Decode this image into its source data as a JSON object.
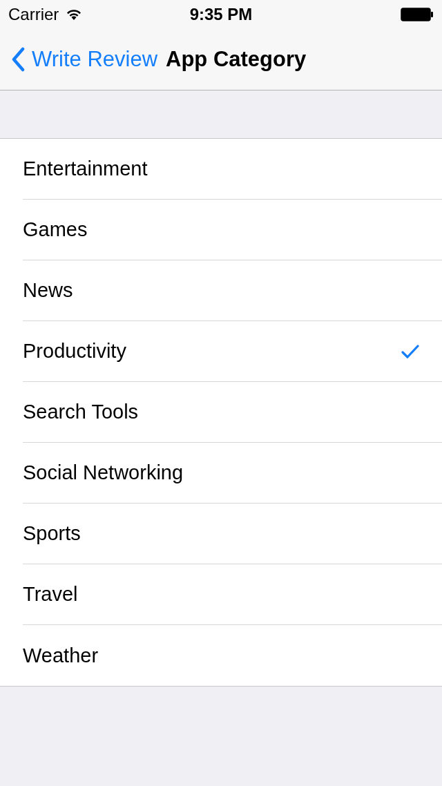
{
  "status_bar": {
    "carrier": "Carrier",
    "time": "9:35 PM"
  },
  "nav_bar": {
    "back": "Write Review",
    "title": "App Category"
  },
  "categories": [
    {
      "label": "Entertainment",
      "selected": false
    },
    {
      "label": "Games",
      "selected": false
    },
    {
      "label": "News",
      "selected": false
    },
    {
      "label": "Productivity",
      "selected": true
    },
    {
      "label": "Search Tools",
      "selected": false
    },
    {
      "label": "Social Networking",
      "selected": false
    },
    {
      "label": "Sports",
      "selected": false
    },
    {
      "label": "Travel",
      "selected": false
    },
    {
      "label": "Weather",
      "selected": false
    }
  ]
}
